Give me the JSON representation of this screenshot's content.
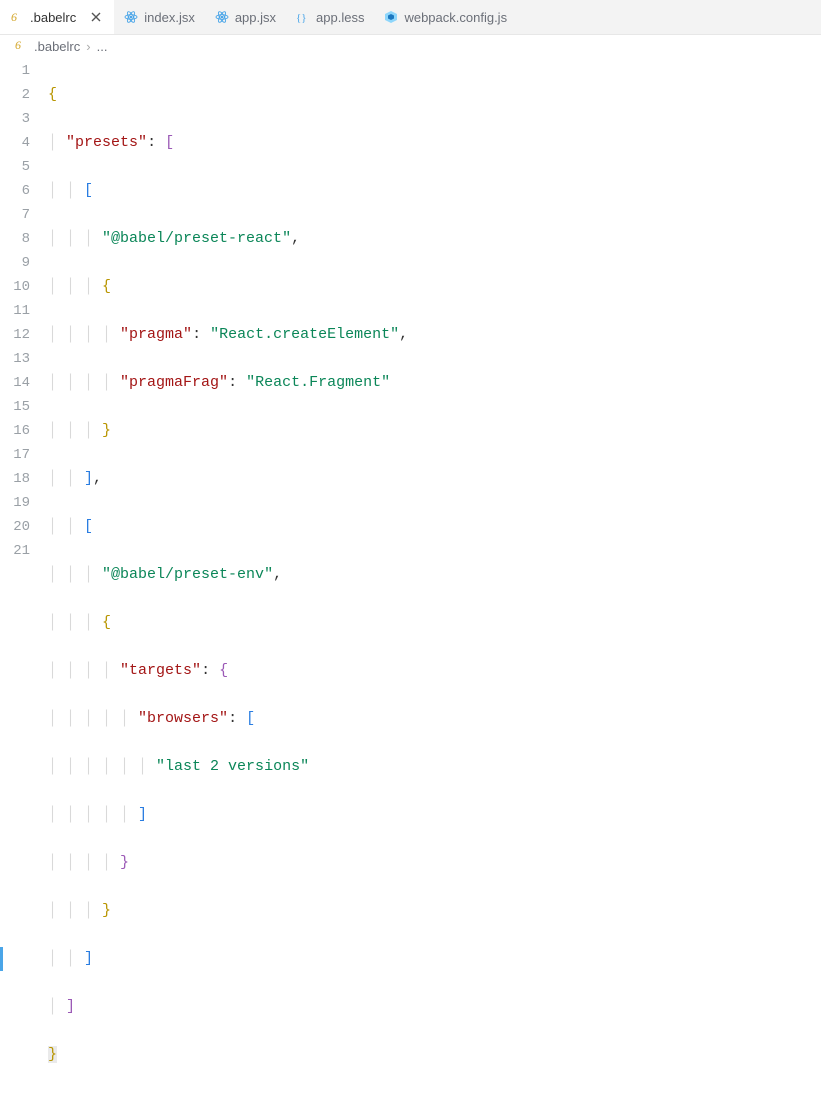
{
  "tabs": [
    {
      "label": ".babelrc",
      "icon": "babel",
      "active": true
    },
    {
      "label": "index.jsx",
      "icon": "react",
      "active": false
    },
    {
      "label": "app.jsx",
      "icon": "react",
      "active": false
    },
    {
      "label": "app.less",
      "icon": "less",
      "active": false
    },
    {
      "label": "webpack.config.js",
      "icon": "webpack",
      "active": false
    }
  ],
  "breadcrumb": {
    "icon": "babel",
    "file": ".babelrc",
    "trail": "..."
  },
  "code": {
    "line_count": 21,
    "highlighted_line": 19,
    "presets": "presets",
    "preset_react": "@babel/preset-react",
    "pragma_key": "pragma",
    "pragma_val": "React.createElement",
    "pragmaFrag_key": "pragmaFrag",
    "pragmaFrag_val": "React.Fragment",
    "preset_env": "@babel/preset-env",
    "targets_key": "targets",
    "browsers_key": "browsers",
    "browsers_val": "last 2 versions"
  }
}
